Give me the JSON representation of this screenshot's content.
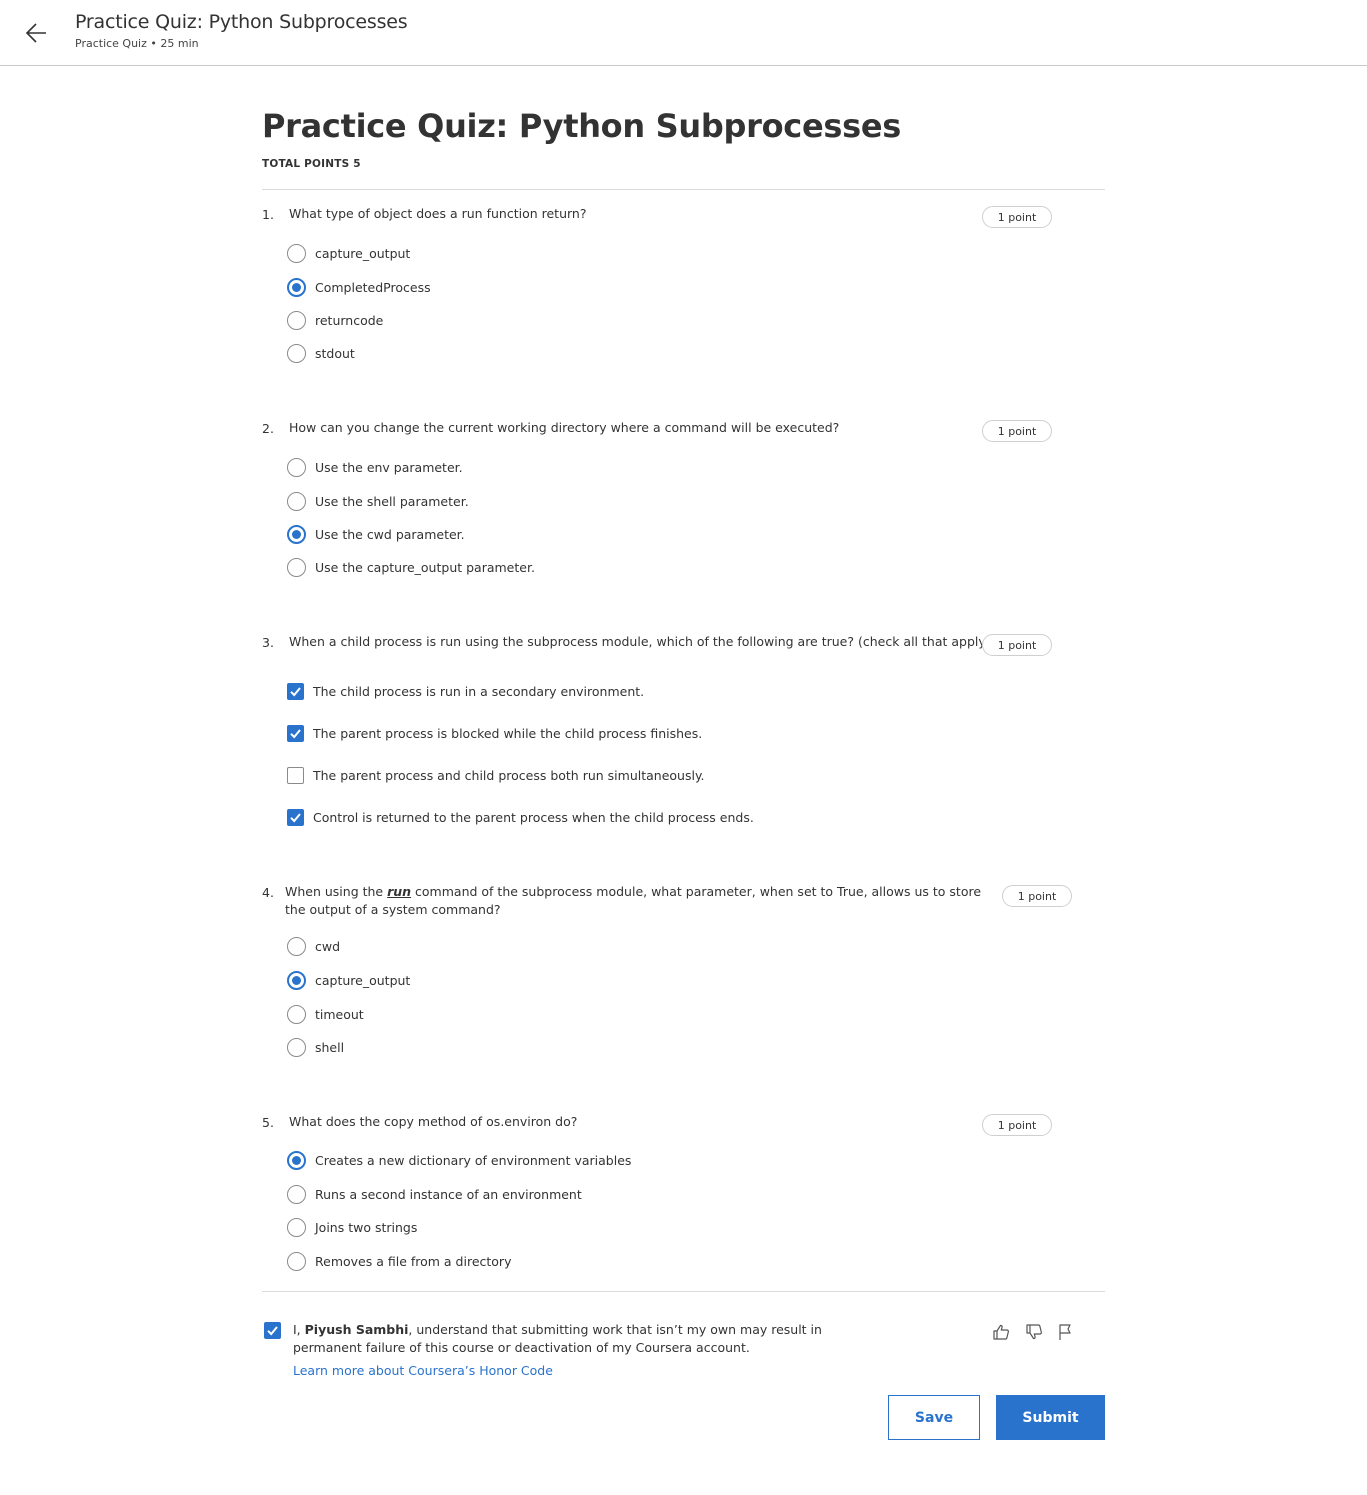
{
  "header": {
    "title": "Practice Quiz: Python Subprocesses",
    "subtitle": "Practice Quiz • 25 min"
  },
  "quiz": {
    "title": "Practice Quiz: Python Subprocesses",
    "total_points": "TOTAL POINTS 5",
    "questions": [
      {
        "number": "1.",
        "text": "What type of object does a run function return?",
        "points": "1 point",
        "type": "radio",
        "options": [
          {
            "label": "capture_output",
            "selected": false
          },
          {
            "label": "CompletedProcess",
            "selected": true
          },
          {
            "label": "returncode",
            "selected": false
          },
          {
            "label": "stdout",
            "selected": false
          }
        ]
      },
      {
        "number": "2.",
        "text": "How can you change the current working directory where a command will be executed?",
        "points": "1 point",
        "type": "radio",
        "options": [
          {
            "label": "Use the env parameter.",
            "selected": false
          },
          {
            "label": "Use the shell parameter.",
            "selected": false
          },
          {
            "label": "Use the cwd parameter.",
            "selected": true
          },
          {
            "label": "Use the capture_output parameter.",
            "selected": false
          }
        ]
      },
      {
        "number": "3.",
        "text": "When a child process is run using the subprocess module, which of the following are true? (check all that apply)",
        "points": "1 point",
        "type": "checkbox",
        "options": [
          {
            "label": "The child process is run in a secondary environment.",
            "selected": true
          },
          {
            "label": "The parent process is blocked while the child process finishes.",
            "selected": true
          },
          {
            "label": "The parent process and child process both run simultaneously.",
            "selected": false
          },
          {
            "label": "Control is returned to the parent process when the child process ends.",
            "selected": true
          }
        ]
      },
      {
        "number": "4.",
        "text_before": "When using the ",
        "text_em": "run",
        "text_after": " command of the subprocess module, what parameter, when set to True, allows us to store the output of a system command?",
        "points": "1 point",
        "type": "radio",
        "options": [
          {
            "label": "cwd",
            "selected": false
          },
          {
            "label": "capture_output",
            "selected": true
          },
          {
            "label": "timeout",
            "selected": false
          },
          {
            "label": "shell",
            "selected": false
          }
        ]
      },
      {
        "number": "5.",
        "text": "What does the copy method of os.environ do?",
        "points": "1 point",
        "type": "radio",
        "options": [
          {
            "label": "Creates a new dictionary of environment variables",
            "selected": true
          },
          {
            "label": "Runs a second instance of an environment",
            "selected": false
          },
          {
            "label": "Joins two strings",
            "selected": false
          },
          {
            "label": "Removes a file from a directory",
            "selected": false
          }
        ]
      }
    ]
  },
  "honor_code": {
    "checked": true,
    "prefix": "I, ",
    "name": "Piyush Sambhi",
    "suffix": ", understand that submitting work that isn’t my own may result in permanent failure of this course or deactivation of my Coursera account.",
    "link": "Learn more about Coursera’s Honor Code"
  },
  "feedback_icons": [
    "thumbs-up-icon",
    "thumbs-down-icon",
    "flag-icon"
  ],
  "buttons": {
    "save": "Save",
    "submit": "Submit"
  },
  "colors": {
    "accent": "#2a73cc",
    "text": "#333333",
    "border": "#c9c9c9"
  }
}
